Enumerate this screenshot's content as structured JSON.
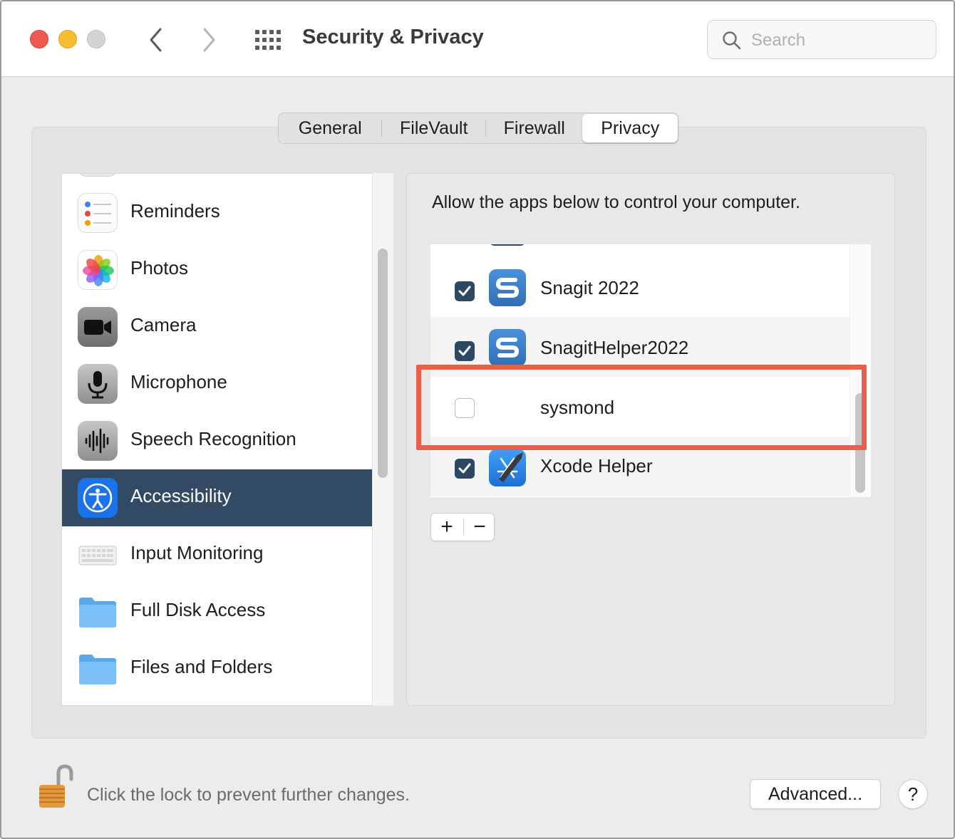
{
  "window": {
    "title": "Security & Privacy"
  },
  "search": {
    "placeholder": "Search"
  },
  "tabs": [
    {
      "label": "General",
      "selected": false
    },
    {
      "label": "FileVault",
      "selected": false
    },
    {
      "label": "Firewall",
      "selected": false
    },
    {
      "label": "Privacy",
      "selected": true
    }
  ],
  "sidebar": {
    "items": [
      {
        "label": "Reminders",
        "icon": "reminders-icon",
        "selected": false
      },
      {
        "label": "Photos",
        "icon": "photos-icon",
        "selected": false
      },
      {
        "label": "Camera",
        "icon": "camera-icon",
        "selected": false
      },
      {
        "label": "Microphone",
        "icon": "microphone-icon",
        "selected": false
      },
      {
        "label": "Speech Recognition",
        "icon": "speech-recognition-icon",
        "selected": false
      },
      {
        "label": "Accessibility",
        "icon": "accessibility-icon",
        "selected": true
      },
      {
        "label": "Input Monitoring",
        "icon": "keyboard-icon",
        "selected": false
      },
      {
        "label": "Full Disk Access",
        "icon": "folder-icon",
        "selected": false
      },
      {
        "label": "Files and Folders",
        "icon": "folder-icon",
        "selected": false
      }
    ]
  },
  "panel": {
    "description": "Allow the apps below to control your computer.",
    "apps": [
      {
        "name": "Snagit 2022",
        "checked": true,
        "icon": "snagit-icon"
      },
      {
        "name": "SnagitHelper2022",
        "checked": true,
        "icon": "snagit-icon"
      },
      {
        "name": "sysmond",
        "checked": false,
        "icon": ""
      },
      {
        "name": "Xcode Helper",
        "checked": true,
        "icon": "xcode-icon"
      }
    ],
    "add_label": "+",
    "remove_label": "−"
  },
  "footer": {
    "lock_text": "Click the lock to prevent further changes.",
    "advanced_label": "Advanced...",
    "help_label": "?"
  },
  "colors": {
    "selection": "#324a63",
    "checkbox": "#2d4862",
    "highlight": "#e8604c",
    "close": "#ee5a52",
    "minimize": "#f5bd2f"
  }
}
